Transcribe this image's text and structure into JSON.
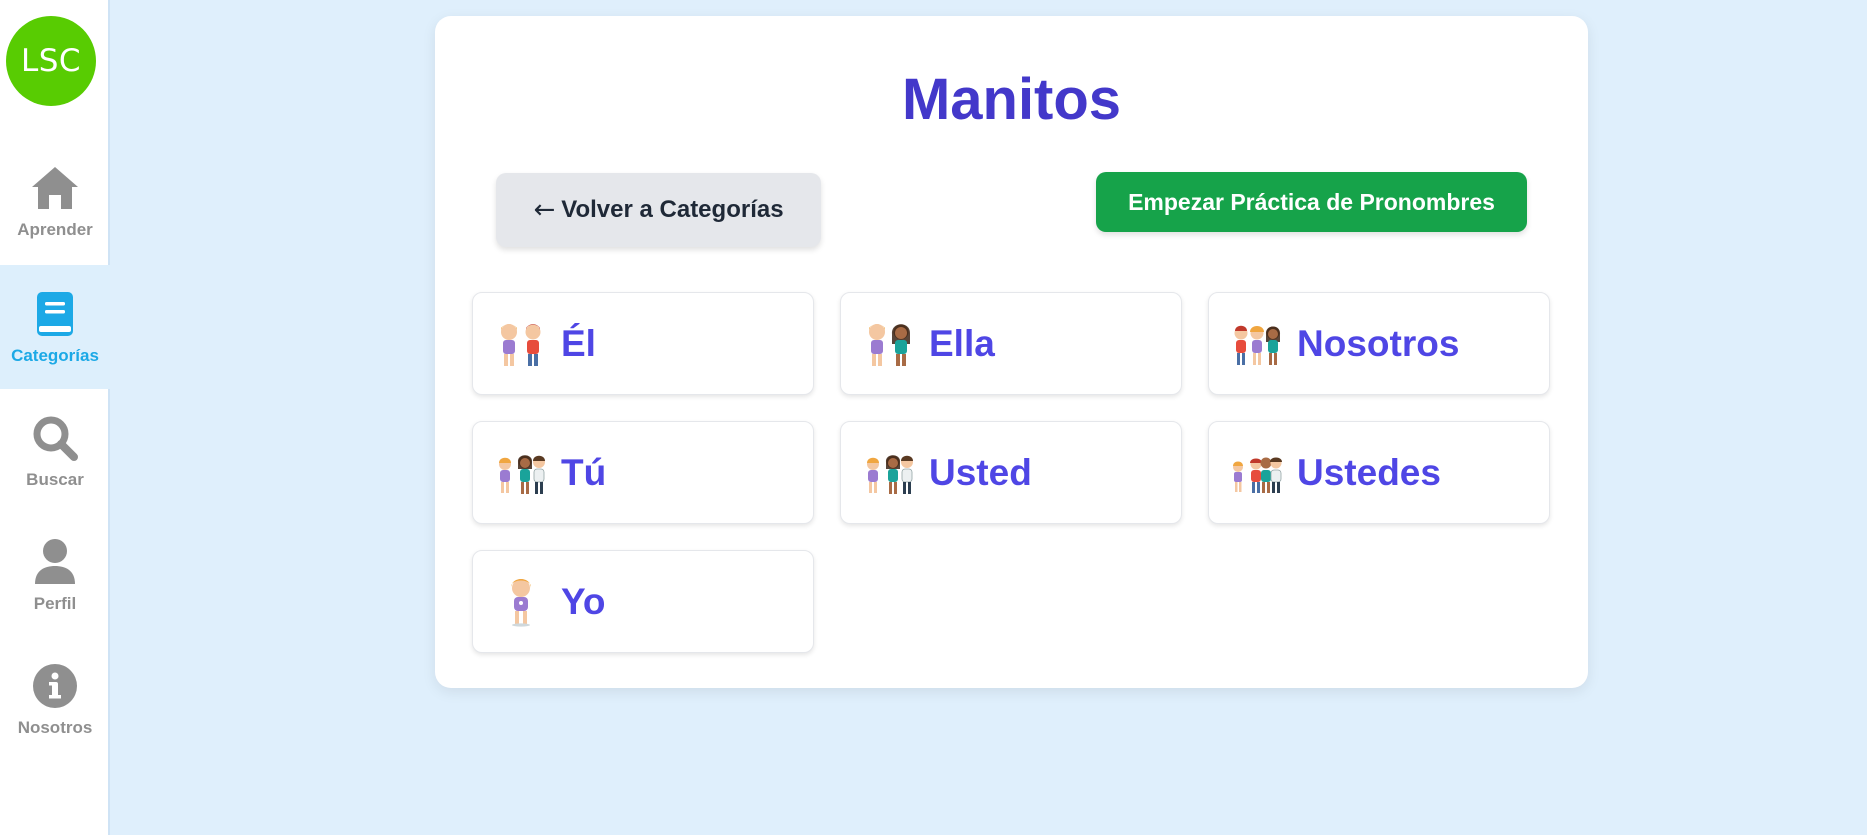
{
  "sidebar": {
    "logo": "LSC",
    "items": [
      {
        "label": "Aprender",
        "icon": "home-icon"
      },
      {
        "label": "Categorías",
        "icon": "book-icon",
        "active": true
      },
      {
        "label": "Buscar",
        "icon": "search-icon"
      },
      {
        "label": "Perfil",
        "icon": "user-icon"
      },
      {
        "label": "Nosotros",
        "icon": "info-icon"
      }
    ]
  },
  "main": {
    "title": "Manitos",
    "back_label": "Volver a Categorías",
    "back_arrow": "←",
    "start_label": "Empezar Práctica de Pronombres",
    "cards": [
      {
        "label": "Él",
        "icon": "two-kids-icon"
      },
      {
        "label": "Ella",
        "icon": "two-kids-icon"
      },
      {
        "label": "Nosotros",
        "icon": "three-kids-icon"
      },
      {
        "label": "Tú",
        "icon": "kids-pointing-icon"
      },
      {
        "label": "Usted",
        "icon": "kids-pointing-icon"
      },
      {
        "label": "Ustedes",
        "icon": "group-kids-icon"
      },
      {
        "label": "Yo",
        "icon": "girl-icon"
      }
    ]
  },
  "colors": {
    "accent": "#4338ca",
    "card_text": "#4f46e5",
    "primary_green": "#16a34a",
    "logo_green": "#58cc02",
    "sidebar_active": "#1ca9e6",
    "background": "#dfeffc"
  }
}
